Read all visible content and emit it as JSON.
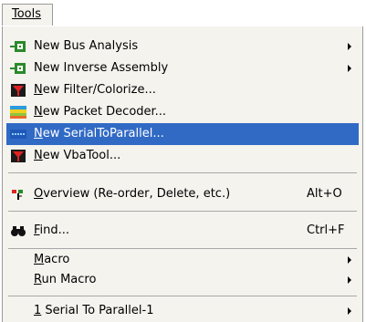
{
  "menubar": {
    "title": "Tools"
  },
  "menu": {
    "group1": [
      {
        "label": "New Bus Analysis",
        "icon": "bus-analysis-icon",
        "submenu": true
      },
      {
        "label": "New Inverse Assembly",
        "icon": "inverse-assembly-icon",
        "submenu": true
      },
      {
        "label": "New Filter/Colorize...",
        "icon": "filter-colorize-icon",
        "submenu": false
      },
      {
        "label": "New Packet Decoder...",
        "icon": "packet-decoder-icon",
        "submenu": false
      },
      {
        "label": "New SerialToParallel...",
        "icon": "serial-to-parallel-icon",
        "submenu": false,
        "selected": true
      },
      {
        "label": "New VbaTool...",
        "icon": "vba-tool-icon",
        "submenu": false
      }
    ],
    "overview": {
      "label": "Overview (Re-order, Delete, etc.)",
      "shortcut": "Alt+O",
      "icon": "overview-icon"
    },
    "find": {
      "label": "Find...",
      "shortcut": "Ctrl+F",
      "icon": "binoculars-icon"
    },
    "macro": {
      "label": "Macro"
    },
    "run_macro": {
      "label": "Run Macro"
    },
    "recent": {
      "label": "1 Serial To Parallel-1"
    }
  },
  "colors": {
    "selection": "#316ac5",
    "menu_bg": "#f4f3ee"
  }
}
